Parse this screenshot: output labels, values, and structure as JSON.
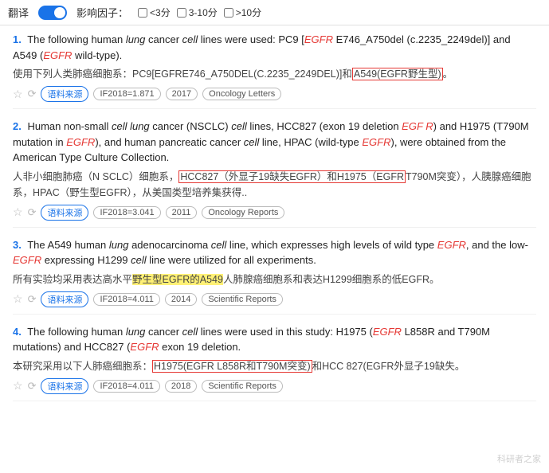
{
  "topbar": {
    "translate_label": "翻译",
    "influence_label": "影响因子：",
    "filter1_label": "<3分",
    "filter2_label": "3-10分",
    "filter3_label": ">10分"
  },
  "results": [
    {
      "number": "1.",
      "en_text_parts": [
        {
          "text": "The following human ",
          "style": "normal"
        },
        {
          "text": "lung",
          "style": "italic"
        },
        {
          "text": " cancer ",
          "style": "normal"
        },
        {
          "text": "cell",
          "style": "italic"
        },
        {
          "text": " lines were used: PC9 [",
          "style": "normal"
        },
        {
          "text": "EGFR",
          "style": "italic-red"
        },
        {
          "text": " E746_A750del (c.2235_2249del)] and A549 (",
          "style": "normal"
        },
        {
          "text": "EGFR",
          "style": "italic-red"
        },
        {
          "text": " wild-type).",
          "style": "normal"
        }
      ],
      "zh_text_parts": [
        {
          "text": "使用下列人类肺癌细胞系：PC9[EGFRE746_A750DEL(C.2235_2249DEL)]和",
          "style": "normal"
        },
        {
          "text": "A549(EGFR野生型)",
          "style": "highlight-red-border"
        },
        {
          "text": "。",
          "style": "normal"
        }
      ],
      "meta": {
        "if": "IF2018=1.871",
        "year": "2017",
        "journal": "Oncology Letters"
      }
    },
    {
      "number": "2.",
      "en_text_parts": [
        {
          "text": "Human non-small ",
          "style": "normal"
        },
        {
          "text": "cell lung",
          "style": "italic"
        },
        {
          "text": " cancer (NSCLC) ",
          "style": "normal"
        },
        {
          "text": "cell",
          "style": "italic"
        },
        {
          "text": " lines, HCC827 (exon 19 deletion ",
          "style": "normal"
        },
        {
          "text": "EGF R",
          "style": "italic-red"
        },
        {
          "text": ") and H1975 (T790M mutation in ",
          "style": "normal"
        },
        {
          "text": "EGFR",
          "style": "italic-red"
        },
        {
          "text": "), and human pancreatic cancer ",
          "style": "normal"
        },
        {
          "text": "cell",
          "style": "italic"
        },
        {
          "text": " line, HPAC (wild-type ",
          "style": "normal"
        },
        {
          "text": "EGFR",
          "style": "italic-red"
        },
        {
          "text": "), were obtained from the American Type Culture Collection.",
          "style": "normal"
        }
      ],
      "zh_text_parts": [
        {
          "text": "人非小细胞肺癌（N SCLC）细胞系，",
          "style": "normal"
        },
        {
          "text": "HCC827（外显子19缺失EGFR）和H1975（EGFR",
          "style": "highlight-red-border"
        },
        {
          "text": "T790M突变），人胰腺癌细胞系，HPAC（野生型EGFR），从美国类型培养集获得..",
          "style": "normal"
        }
      ],
      "meta": {
        "if": "IF2018=3.041",
        "year": "2011",
        "journal": "Oncology Reports"
      }
    },
    {
      "number": "3.",
      "en_text_parts": [
        {
          "text": "The A549 human ",
          "style": "normal"
        },
        {
          "text": "lung",
          "style": "italic"
        },
        {
          "text": " adenocarcinoma ",
          "style": "normal"
        },
        {
          "text": "cell",
          "style": "italic"
        },
        {
          "text": " line, which expresses high levels of wild type ",
          "style": "normal"
        },
        {
          "text": "EGFR",
          "style": "italic-red"
        },
        {
          "text": ", and the low-",
          "style": "normal"
        },
        {
          "text": "EGFR",
          "style": "italic-red"
        },
        {
          "text": " expressing H1299 ",
          "style": "normal"
        },
        {
          "text": "cell",
          "style": "italic"
        },
        {
          "text": " line were utilized for all experiments.",
          "style": "normal"
        }
      ],
      "zh_text_parts": [
        {
          "text": "所有实验均采用表达高水平",
          "style": "normal"
        },
        {
          "text": "野生型EGFR的A549",
          "style": "highlight-yellow"
        },
        {
          "text": "人肺腺癌细胞系和表达H1299细胞系的低EGFR。",
          "style": "normal"
        }
      ],
      "meta": {
        "if": "IF2018=4.011",
        "year": "2014",
        "journal": "Scientific Reports"
      }
    },
    {
      "number": "4.",
      "en_text_parts": [
        {
          "text": "The following human ",
          "style": "normal"
        },
        {
          "text": "lung",
          "style": "italic"
        },
        {
          "text": " cancer ",
          "style": "normal"
        },
        {
          "text": "cell",
          "style": "italic"
        },
        {
          "text": " lines were used in this study: H1975 (",
          "style": "normal"
        },
        {
          "text": "EGFR",
          "style": "italic-red"
        },
        {
          "text": " L858R and T790M mutations) and HCC827 (",
          "style": "normal"
        },
        {
          "text": "EGFR",
          "style": "italic-red"
        },
        {
          "text": " exon 19 deletion.",
          "style": "normal"
        }
      ],
      "zh_text_parts": [
        {
          "text": "本研究采用以下人肺癌细胞系：",
          "style": "normal"
        },
        {
          "text": "H1975(EGFR L858R和T790M突变)",
          "style": "highlight-red-border"
        },
        {
          "text": "和HCC 827(EGFR外显子19缺失。",
          "style": "normal"
        }
      ],
      "meta": {
        "if": "IF2018=4.011",
        "year": "2018",
        "journal": "Scientific Reports"
      }
    }
  ],
  "meta_labels": {
    "source": "语料来源"
  },
  "watermark": "科研者之家"
}
